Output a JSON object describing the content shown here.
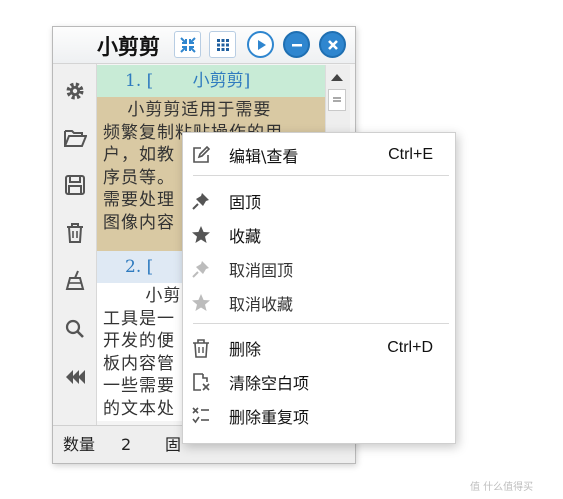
{
  "window": {
    "title": "小剪剪",
    "title_buttons": [
      "collapse-icon",
      "grid-icon",
      "play-icon",
      "minus-icon",
      "close-icon"
    ]
  },
  "sidebar": {
    "icons": [
      "gear-icon",
      "folder-open-icon",
      "save-icon",
      "trash-icon",
      "broom-icon",
      "search-icon",
      "layers-icon"
    ]
  },
  "items": [
    {
      "header": "1. [　　 小剪剪]",
      "body_lines": [
        "　 小剪剪适用于需要",
        "频繁复制粘贴操作的用",
        "户，如教",
        "序员等。",
        "需要处理",
        "图像内容"
      ]
    },
    {
      "header": "2. [",
      "body_lines": [
        "　　 小剪",
        "工具是一",
        "开发的便",
        "板内容管",
        "一些需要",
        "的文本处"
      ]
    }
  ],
  "status": {
    "count_label": "数量",
    "count_value": "2",
    "pinned_label": "固"
  },
  "context_menu": {
    "items": [
      {
        "label": "编辑\\查看",
        "shortcut": "Ctrl+E",
        "icon": "edit-icon",
        "enabled": true
      },
      {
        "label": "固顶",
        "shortcut": "",
        "icon": "pin-icon",
        "enabled": true
      },
      {
        "label": "收藏",
        "shortcut": "",
        "icon": "star-icon",
        "enabled": true
      },
      {
        "label": "取消固顶",
        "shortcut": "",
        "icon": "unpin-icon",
        "enabled": true
      },
      {
        "label": "取消收藏",
        "shortcut": "",
        "icon": "unstar-icon",
        "enabled": true
      },
      {
        "label": "删除",
        "shortcut": "Ctrl+D",
        "icon": "trash-icon",
        "enabled": true
      },
      {
        "label": "清除空白项",
        "shortcut": "",
        "icon": "clear-blank-icon",
        "enabled": true
      },
      {
        "label": "删除重复项",
        "shortcut": "",
        "icon": "remove-duplicates-icon",
        "enabled": true
      }
    ]
  },
  "watermark": "值 什么值得买",
  "colors": {
    "accent": "#2f86cf",
    "item1_header_bg": "#c8ebd6",
    "item1_body_bg": "#d9c9a3",
    "item2_header_bg": "#dfe9f4"
  }
}
